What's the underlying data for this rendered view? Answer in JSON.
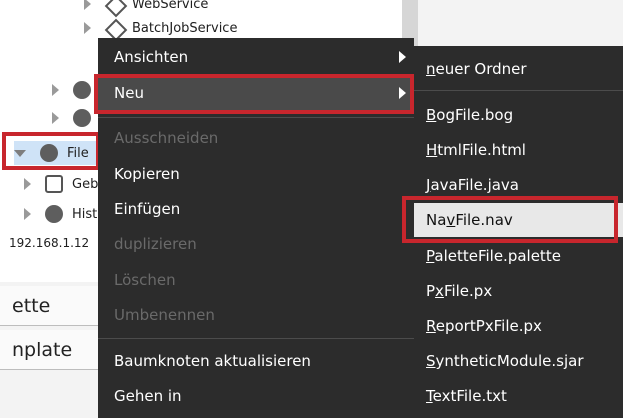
{
  "tree": {
    "rows": [
      {
        "label": "WebService",
        "icon": "service-icon"
      },
      {
        "label": "BatchJobService",
        "icon": "service-icon"
      },
      {
        "label": "File",
        "icon": "file-node-icon"
      },
      {
        "label": "Geb",
        "icon": "building-icon"
      },
      {
        "label": "Hist",
        "icon": "history-icon"
      }
    ],
    "ip": "192.168.1.12"
  },
  "bottom_panel": {
    "palette_label": "ette",
    "template_label": "nplate"
  },
  "context_menu": {
    "items": [
      {
        "label": "Ansichten",
        "disabled": false,
        "submenu": true
      },
      {
        "label": "Neu",
        "disabled": false,
        "submenu": true
      },
      {
        "label": "Ausschneiden",
        "disabled": true
      },
      {
        "label": "Kopieren",
        "disabled": false
      },
      {
        "label": "Einfügen",
        "disabled": false
      },
      {
        "label": "duplizieren",
        "disabled": true
      },
      {
        "label": "Löschen",
        "disabled": true
      },
      {
        "label": "Umbenennen",
        "disabled": true
      },
      {
        "label": "Baumknoten aktualisieren",
        "disabled": false
      },
      {
        "label": "Gehen in",
        "disabled": false
      }
    ]
  },
  "submenu": {
    "items": [
      {
        "prefix": "",
        "key": "n",
        "rest": "euer Ordner"
      },
      {
        "prefix": "",
        "key": "B",
        "rest": "ogFile.bog"
      },
      {
        "prefix": "",
        "key": "H",
        "rest": "tmlFile.html"
      },
      {
        "prefix": "",
        "key": "J",
        "rest": "avaFile.java"
      },
      {
        "prefix": "Na",
        "key": "v",
        "rest": "File.nav"
      },
      {
        "prefix": "",
        "key": "P",
        "rest": "aletteFile.palette"
      },
      {
        "prefix": "P",
        "key": "x",
        "rest": "File.px"
      },
      {
        "prefix": "",
        "key": "R",
        "rest": "eportPxFile.px"
      },
      {
        "prefix": "",
        "key": "S",
        "rest": "yntheticModule.sjar"
      },
      {
        "prefix": "",
        "key": "T",
        "rest": "extFile.txt"
      }
    ]
  },
  "colors": {
    "highlight": "#c8262d",
    "menu_bg": "#2c2c2c",
    "menu_active": "#4a4a4a",
    "submenu_hover": "#e8e8e8"
  }
}
